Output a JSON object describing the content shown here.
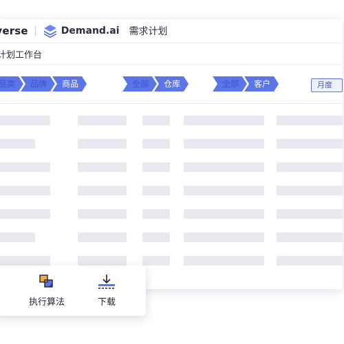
{
  "header": {
    "brand_prefix": "iverse",
    "brand_name": "Demand.ai",
    "module": "需求计划"
  },
  "page": {
    "title": "计划工作台"
  },
  "filters": {
    "product_path": [
      "品类",
      "品牌",
      "商品"
    ],
    "warehouse_path": [
      "全部",
      "仓库"
    ],
    "customer_path": [
      "全部",
      "客户"
    ],
    "period": "月度"
  },
  "toolbar": {
    "run_algorithm": "执行算法",
    "download": "下载"
  },
  "colors": {
    "accent": "#5b74e6",
    "skeleton": "#e9eaf0",
    "logo": "#4f6fe0"
  },
  "icons": [
    "logo-layers-icon",
    "run-algorithm-icon",
    "download-icon"
  ]
}
